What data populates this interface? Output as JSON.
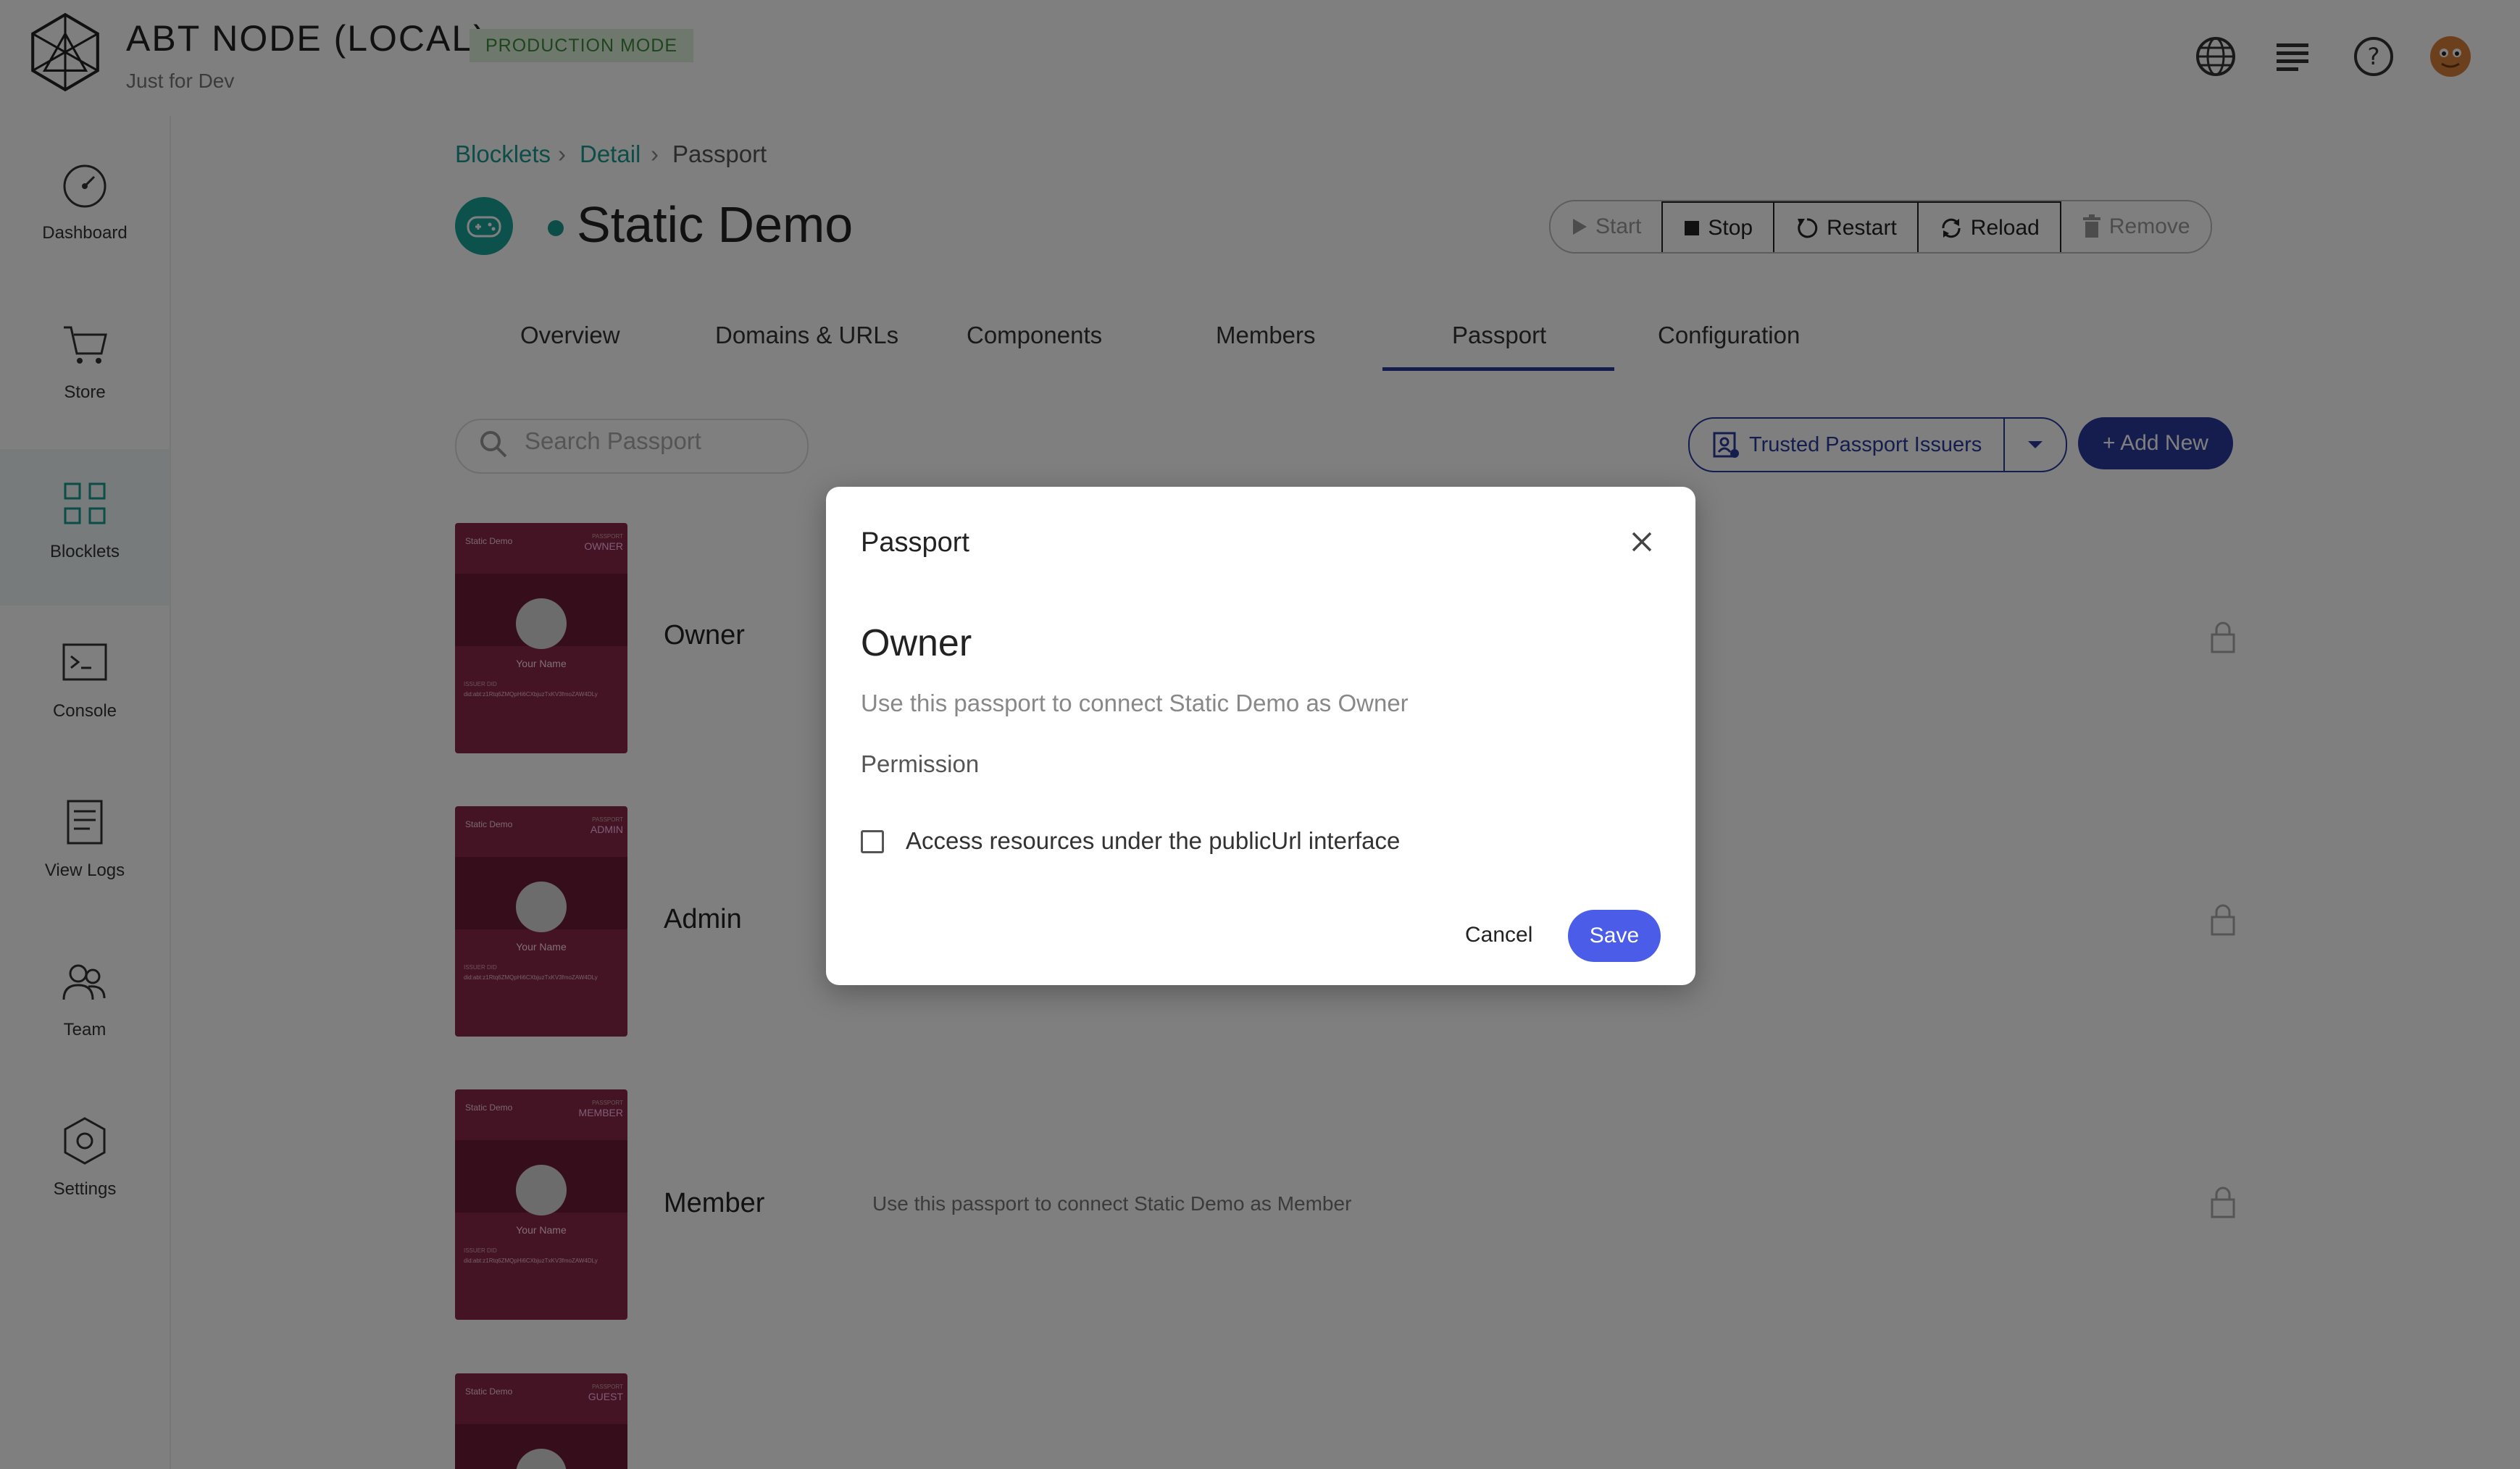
{
  "header": {
    "app_title": "ABT NODE (LOCAL)",
    "mode_badge": "PRODUCTION MODE",
    "subtitle": "Just for Dev",
    "icons": [
      "globe-icon",
      "list-icon",
      "help-icon",
      "user-avatar"
    ]
  },
  "sidebar": {
    "items": [
      {
        "label": "Dashboard",
        "icon": "dashboard-icon"
      },
      {
        "label": "Store",
        "icon": "cart-icon"
      },
      {
        "label": "Blocklets",
        "icon": "blocklets-icon",
        "active": true
      },
      {
        "label": "Console",
        "icon": "console-icon"
      },
      {
        "label": "View Logs",
        "icon": "logs-icon"
      },
      {
        "label": "Team",
        "icon": "team-icon"
      },
      {
        "label": "Settings",
        "icon": "settings-icon"
      }
    ]
  },
  "breadcrumb": {
    "items": [
      "Blocklets",
      "Detail",
      "Passport"
    ],
    "separator": "›"
  },
  "blocklet": {
    "title": "Static Demo",
    "status_color": "#1a9a8f"
  },
  "actions": {
    "start": "Start",
    "stop": "Stop",
    "restart": "Restart",
    "reload": "Reload",
    "remove": "Remove"
  },
  "tabs": [
    {
      "label": "Overview"
    },
    {
      "label": "Domains & URLs"
    },
    {
      "label": "Components"
    },
    {
      "label": "Members"
    },
    {
      "label": "Passport",
      "active": true
    },
    {
      "label": "Configuration"
    }
  ],
  "search": {
    "placeholder": "Search Passport"
  },
  "issuers_button": "Trusted Passport Issuers",
  "add_new_button": "+ Add New",
  "passports": [
    {
      "label": "Owner",
      "role_tag": "OWNER",
      "desc": ""
    },
    {
      "label": "Admin",
      "role_tag": "ADMIN",
      "desc": ""
    },
    {
      "label": "Member",
      "role_tag": "MEMBER",
      "desc": "Use this passport to connect Static Demo as Member"
    },
    {
      "label": "",
      "role_tag": "GUEST",
      "desc": ""
    }
  ],
  "passport_card": {
    "org": "Static Demo",
    "tag": "PASSPORT",
    "your_name": "Your Name",
    "did_label": "ISSUER DID",
    "did_value": "did:abt:z1Rtq6ZMQpHi6CXbjuzTxKV3fmoZAW4DLy"
  },
  "dialog": {
    "title": "Passport",
    "role": "Owner",
    "description": "Use this passport to connect Static Demo as Owner",
    "permission_label": "Permission",
    "checkbox_label": "Access resources under the publicUrl interface",
    "checkbox_checked": false,
    "cancel": "Cancel",
    "save": "Save"
  },
  "colors": {
    "accent": "#2b3a9c",
    "link": "#1a9a8f",
    "save": "#4b5de8",
    "card": "#8b2848"
  }
}
